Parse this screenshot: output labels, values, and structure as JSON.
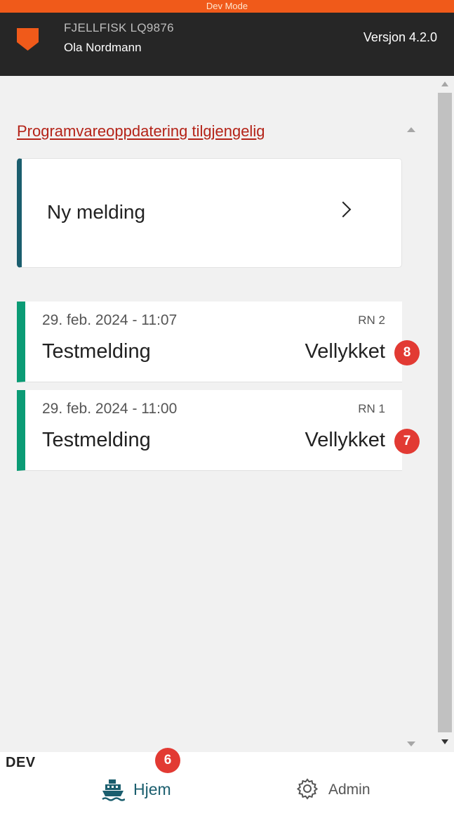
{
  "devbar": {
    "label": "Dev Mode"
  },
  "header": {
    "vessel": "FJELLFISK LQ9876",
    "user": "Ola Nordmann",
    "version": "Versjon 4.2.0"
  },
  "update_link": "Programvareoppdatering tilgjengelig",
  "new_message": {
    "label": "Ny melding"
  },
  "messages": [
    {
      "date": "29. feb. 2024 - 11:07",
      "rn": "RN 2",
      "name": "Testmelding",
      "status": "Vellykket",
      "badge": "8"
    },
    {
      "date": "29. feb. 2024 - 11:00",
      "rn": "RN 1",
      "name": "Testmelding",
      "status": "Vellykket",
      "badge": "7"
    }
  ],
  "bottom_nav": {
    "env_label": "DEV",
    "home_label": "Hjem",
    "home_badge": "6",
    "admin_label": "Admin"
  },
  "colors": {
    "devbar": "#f05a1a",
    "header_bg": "#262626",
    "accent_teal": "#1b5e6e",
    "success_green": "#0b9b75",
    "link_red": "#b42318",
    "badge_red": "#e23a33",
    "logo_orange": "#f05a1a"
  },
  "icons": {
    "logo": "shield-logo",
    "home": "ship-icon",
    "admin": "gear-icon",
    "chevron": "chevron-right-icon"
  }
}
